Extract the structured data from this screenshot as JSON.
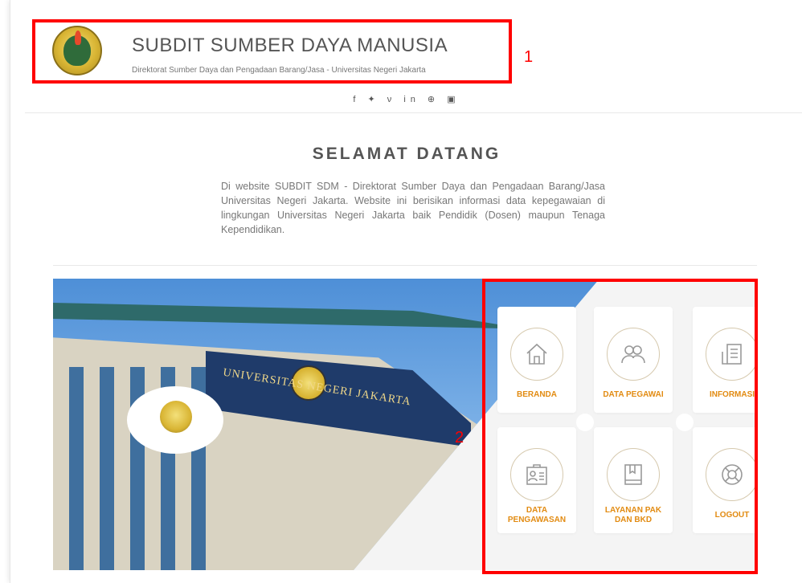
{
  "header": {
    "title": "SUBDIT SUMBER DAYA MANUSIA",
    "subtitle": "Direktorat Sumber Daya dan Pengadaan Barang/Jasa - Universitas Negeri Jakarta"
  },
  "social": {
    "icons": "f  ✦  ν  in  ⊕  ▣",
    "names": [
      "facebook-icon",
      "twitter-icon",
      "vimeo-icon",
      "linkedin-icon",
      "dribbble-icon",
      "instagram-icon"
    ]
  },
  "welcome": {
    "title": "SELAMAT DATANG",
    "text": "Di website SUBDIT SDM - Direktorat Sumber Daya dan Pengadaan Barang/Jasa Universitas Negeri Jakarta. Website ini berisikan informasi data kepegawaian di lingkungan Universitas Negeri Jakarta baik Pendidik (Dosen) maupun Tenaga Kependidikan."
  },
  "banner": {
    "building_sign": "UNIVERSITAS NEGERI JAKARTA"
  },
  "menu": {
    "items": [
      {
        "label": "BERANDA",
        "icon": "home-icon"
      },
      {
        "label": "DATA PEGAWAI",
        "icon": "users-icon"
      },
      {
        "label": "INFORMASI",
        "icon": "document-icon"
      },
      {
        "label": "DATA PENGAWASAN",
        "line1": "DATA",
        "line2": "PENGAWASAN",
        "icon": "id-card-icon"
      },
      {
        "label": "LAYANAN PAK DAN BKD",
        "line1": "LAYANAN PAK",
        "line2": "DAN BKD",
        "icon": "book-icon"
      },
      {
        "label": "LOGOUT",
        "icon": "lifebuoy-icon"
      }
    ]
  },
  "annotations": {
    "box1_label": "1",
    "box2_label": "2"
  },
  "colors": {
    "accent": "#e28b12",
    "annotation": "#ff0000",
    "icon_ring": "#d6c9ae"
  }
}
